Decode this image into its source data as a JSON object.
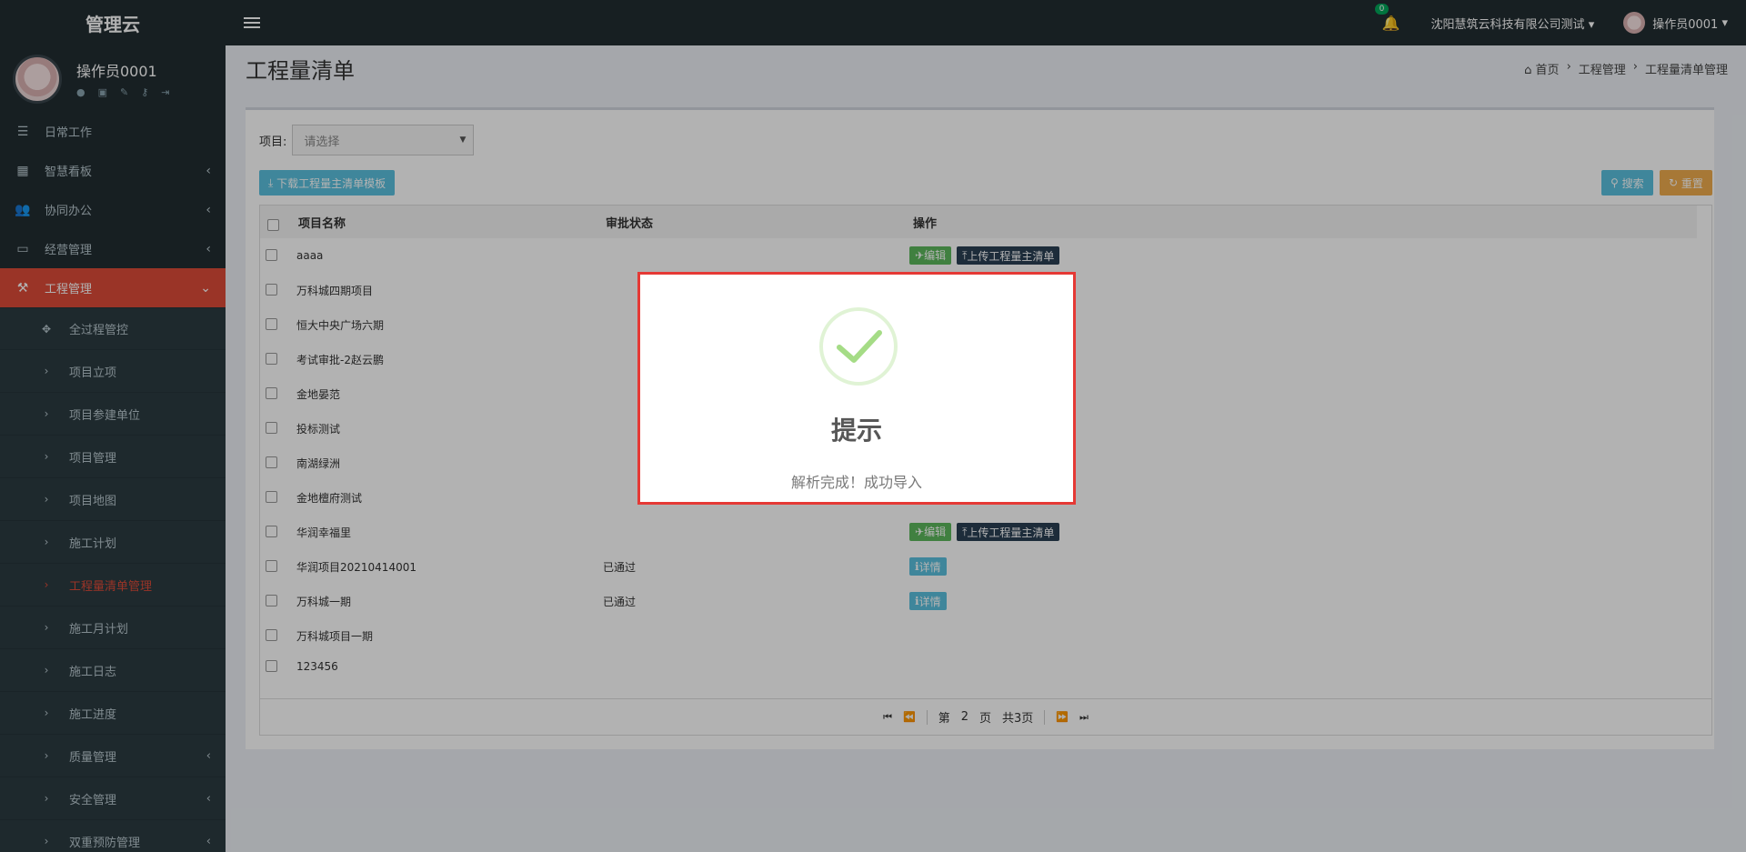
{
  "app": {
    "title": "管理云"
  },
  "user": {
    "name": "操作员0001",
    "icons": [
      "user-icon",
      "id-card-icon",
      "edit-icon",
      "key-icon",
      "logout-icon"
    ]
  },
  "navbar": {
    "notification_count": "0",
    "company": "沈阳慧筑云科技有限公司测试",
    "user_name": "操作员0001"
  },
  "sidebar": {
    "items": [
      {
        "label": "日常工作",
        "icon": "indent-icon"
      },
      {
        "label": "智慧看板",
        "icon": "dashboard-icon",
        "caret": "‹"
      },
      {
        "label": "协同办公",
        "icon": "users-icon",
        "caret": "‹"
      },
      {
        "label": "经营管理",
        "icon": "monitor-icon",
        "caret": "‹"
      },
      {
        "label": "工程管理",
        "icon": "gavel-icon",
        "caret": "⌄",
        "active": true
      }
    ],
    "subitems": [
      {
        "label": "全过程管控"
      },
      {
        "label": "项目立项"
      },
      {
        "label": "项目参建单位"
      },
      {
        "label": "项目管理"
      },
      {
        "label": "项目地图"
      },
      {
        "label": "施工计划"
      },
      {
        "label": "工程量清单管理",
        "selected": true
      },
      {
        "label": "施工月计划"
      },
      {
        "label": "施工日志"
      },
      {
        "label": "施工进度"
      },
      {
        "label": "质量管理",
        "caret": "‹"
      },
      {
        "label": "安全管理",
        "caret": "‹"
      },
      {
        "label": "双重预防管理",
        "caret": "‹"
      }
    ]
  },
  "page": {
    "title": "工程量清单",
    "breadcrumb": [
      "首页",
      "工程管理",
      "工程量清单管理"
    ]
  },
  "filter": {
    "label": "项目:",
    "placeholder": "请选择"
  },
  "toolbar": {
    "download": "下载工程量主清单模板",
    "search": "搜索",
    "reset": "重置"
  },
  "table": {
    "headers": [
      "项目名称",
      "审批状态",
      "操作"
    ],
    "rows": [
      {
        "name": "aaaa",
        "status": "",
        "actions": [
          "编辑",
          "上传工程量主清单"
        ]
      },
      {
        "name": "万科城四期项目",
        "status": "",
        "actions": []
      },
      {
        "name": "恒大中央广场六期",
        "status": "",
        "actions": []
      },
      {
        "name": "考试审批-2赵云鹏",
        "status": "",
        "actions": []
      },
      {
        "name": "金地晏范",
        "status": "",
        "actions": []
      },
      {
        "name": "投标测试",
        "status": "",
        "actions": []
      },
      {
        "name": "南湖绿洲",
        "status": "",
        "actions": []
      },
      {
        "name": "金地檀府测试",
        "status": "",
        "actions": []
      },
      {
        "name": "华润幸福里",
        "status": "",
        "actions": [
          "编辑",
          "上传工程量主清单"
        ]
      },
      {
        "name": "华润项目20210414001",
        "status": "已通过",
        "actions": [
          "详情"
        ]
      },
      {
        "name": "万科城一期",
        "status": "已通过",
        "actions": [
          "详情"
        ]
      },
      {
        "name": "万科城项目一期",
        "status": "",
        "actions": []
      },
      {
        "name": "123456",
        "status": "",
        "actions": []
      }
    ]
  },
  "pager": {
    "page_prefix": "第",
    "page": "2",
    "page_suffix": "页",
    "total": "共3页"
  },
  "modal": {
    "title": "提示",
    "message": "解析完成！成功导入"
  }
}
